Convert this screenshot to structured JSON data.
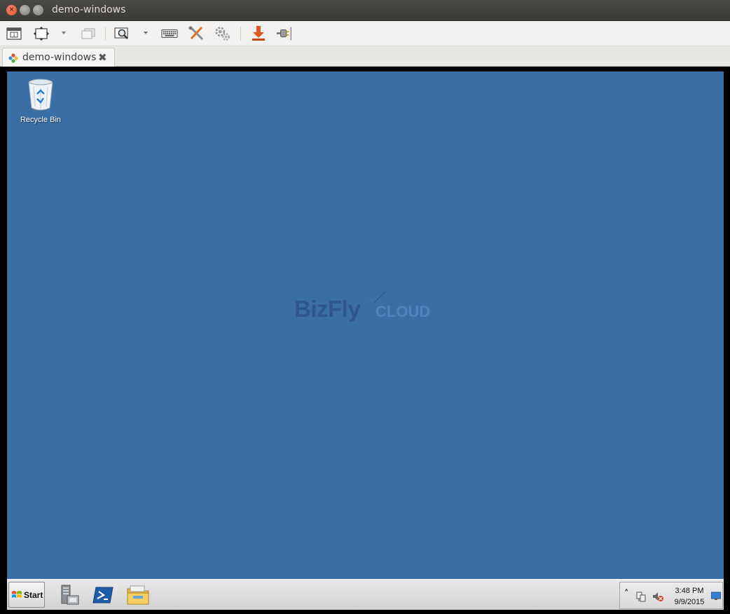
{
  "window": {
    "title": "demo-windows",
    "controls": [
      "close",
      "minimize",
      "maximize"
    ]
  },
  "toolbar": {
    "buttons": [
      {
        "name": "screenshot-icon"
      },
      {
        "name": "fullscreen-icon"
      },
      {
        "name": "scale-dropdown-arrow"
      },
      {
        "name": "windowed-icon"
      },
      {
        "name": "zoom-icon"
      },
      {
        "name": "zoom-dropdown-arrow"
      },
      {
        "name": "keyboard-icon"
      },
      {
        "name": "tools-icon"
      },
      {
        "name": "settings-icon"
      },
      {
        "name": "download-icon"
      },
      {
        "name": "plug-icon"
      }
    ]
  },
  "tab": {
    "label": "demo-windows",
    "close_glyph": "✖"
  },
  "desktop": {
    "background": "#3a6ea5",
    "icons": [
      {
        "label": "Recycle Bin",
        "icon": "recycle-bin-icon"
      }
    ],
    "watermark": {
      "brand": "BizFly",
      "sub": "CLOUD"
    }
  },
  "taskbar": {
    "start_label": "Start",
    "pinned": [
      {
        "icon": "server-manager-icon"
      },
      {
        "icon": "powershell-icon"
      },
      {
        "icon": "file-explorer-icon"
      }
    ],
    "tray": {
      "show_hidden": "˄",
      "time": "3:48 PM",
      "date": "9/9/2015"
    }
  }
}
